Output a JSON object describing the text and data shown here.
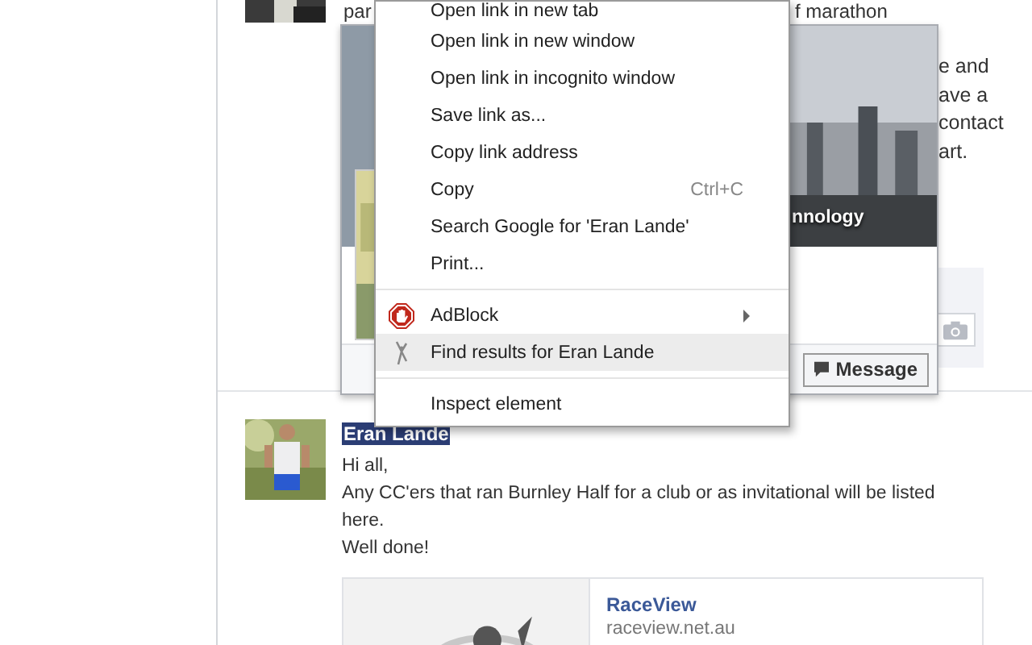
{
  "first_post": {
    "line_start": "par",
    "line_end": "f marathon",
    "right_lines": [
      "e and",
      "ave a",
      "contact",
      "art."
    ]
  },
  "hover_card": {
    "cover_caption": "nnology",
    "message_button": "Message"
  },
  "context_menu": {
    "items": [
      {
        "kind": "item",
        "label": "Open link in new tab",
        "selected": false
      },
      {
        "kind": "item",
        "label": "Open link in new window",
        "selected": false
      },
      {
        "kind": "item",
        "label": "Open link in incognito window",
        "selected": false
      },
      {
        "kind": "item",
        "label": "Save link as...",
        "selected": false
      },
      {
        "kind": "item",
        "label": "Copy link address",
        "selected": false
      },
      {
        "kind": "item",
        "label": "Copy",
        "shortcut": "Ctrl+C",
        "selected": false
      },
      {
        "kind": "item",
        "label": "Search Google for 'Eran Lande'",
        "selected": false
      },
      {
        "kind": "item",
        "label": "Print...",
        "selected": false
      },
      {
        "kind": "separator"
      },
      {
        "kind": "adblock",
        "label": "AdBlock",
        "submenu": true,
        "selected": false
      },
      {
        "kind": "finder",
        "label": "Find results for Eran Lande",
        "selected": true
      },
      {
        "kind": "separator"
      },
      {
        "kind": "item",
        "label": "Inspect element",
        "selected": false
      }
    ]
  },
  "second_post": {
    "author": "Eran Lande",
    "author_highlighted": true,
    "lines": [
      "Hi all,",
      "Any CC'ers that ran Burnley Half for a club or as invitational will be listed",
      "here.",
      "Well done!"
    ],
    "link_preview": {
      "title": "RaceView",
      "domain": "raceview.net.au"
    }
  }
}
